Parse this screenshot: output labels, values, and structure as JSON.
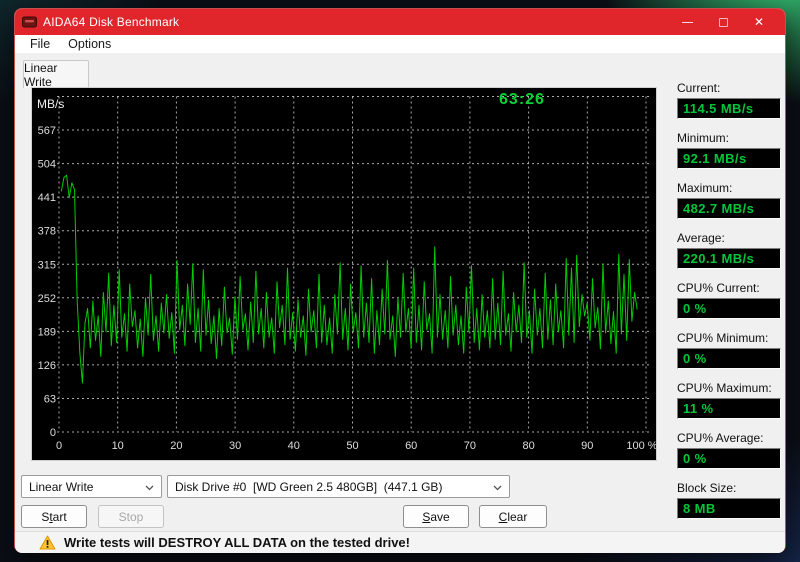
{
  "window": {
    "title": "AIDA64 Disk Benchmark"
  },
  "menu": {
    "items": [
      "File",
      "Options"
    ]
  },
  "tabs": [
    {
      "label": "Linear Write"
    }
  ],
  "icons": {
    "close": "✕",
    "minimize": "minimize-bar",
    "maximize": "maximize-box",
    "chevron": "chevron-down",
    "warning": "warning-triangle",
    "app": "aida64-logo"
  },
  "colors": {
    "titlebar_red": "#E0252B",
    "window_border": "#C7504E",
    "value_green": "#00C63A",
    "timer_green": "#00D435"
  },
  "chart_data": {
    "type": "line",
    "title": "Linear Write",
    "unit": "MB/s",
    "elapsed_time": "63:26",
    "ylabel": "MB/s",
    "y_ticks": [
      567,
      504,
      441,
      378,
      315,
      252,
      189,
      126,
      63,
      0
    ],
    "xlabel_ticks": [
      "0",
      "10",
      "20",
      "30",
      "40",
      "50",
      "60",
      "70",
      "80",
      "90",
      "100 %"
    ],
    "ylim": [
      0,
      630
    ],
    "xlim_pct": [
      0,
      100
    ],
    "x_start_pct": 0.4,
    "x_end_pct": 98.5,
    "grid": true,
    "line_color": "#00CC00",
    "grid_color": "#C8C8C8",
    "stats": {
      "current": 114.5,
      "minimum": 92.1,
      "maximum": 482.7,
      "average": 220.1
    },
    "values": [
      452,
      478,
      482,
      440,
      468,
      455,
      250,
      150,
      92,
      205,
      232,
      158,
      246,
      172,
      218,
      142,
      262,
      188,
      298,
      162,
      238,
      168,
      305,
      178,
      222,
      152,
      278,
      198,
      228,
      158,
      212,
      142,
      252,
      182,
      296,
      172,
      218,
      152,
      242,
      186,
      258,
      176,
      224,
      148,
      322,
      192,
      238,
      162,
      278,
      202,
      316,
      168,
      232,
      152,
      305,
      182,
      248,
      166,
      218,
      138,
      232,
      162,
      272,
      186,
      214,
      146,
      254,
      174,
      292,
      192,
      222,
      154,
      244,
      168,
      302,
      184,
      232,
      158,
      262,
      178,
      214,
      148,
      282,
      196,
      238,
      164,
      308,
      174,
      224,
      152,
      248,
      178,
      218,
      144,
      268,
      188,
      228,
      158,
      296,
      168,
      238,
      164,
      214,
      148,
      258,
      184,
      318,
      174,
      232,
      154,
      278,
      188,
      224,
      158,
      312,
      178,
      242,
      168,
      288,
      148,
      228,
      164,
      268,
      184,
      322,
      174,
      218,
      142,
      252,
      178,
      298,
      188,
      232,
      158,
      308,
      168,
      238,
      154,
      282,
      192,
      222,
      148,
      348,
      178,
      258,
      174,
      228,
      158,
      292,
      182,
      238,
      164,
      218,
      148,
      272,
      188,
      312,
      168,
      232,
      154,
      258,
      178,
      228,
      158,
      288,
      174,
      242,
      164,
      302,
      182,
      222,
      152,
      262,
      188,
      238,
      168,
      318,
      178,
      228,
      148,
      268,
      182,
      232,
      158,
      298,
      174,
      248,
      164,
      278,
      188,
      228,
      158,
      326,
      182,
      308,
      168,
      332,
      198,
      258,
      218,
      242,
      172,
      288,
      196,
      234,
      156,
      316,
      186,
      246,
      166,
      226,
      148,
      334,
      184,
      296,
      172,
      324,
      208,
      262,
      230
    ]
  },
  "stats": [
    {
      "label": "Current:",
      "value": "114.5 MB/s"
    },
    {
      "label": "Minimum:",
      "value": "92.1 MB/s"
    },
    {
      "label": "Maximum:",
      "value": "482.7 MB/s"
    },
    {
      "label": "Average:",
      "value": "220.1 MB/s"
    },
    {
      "label": "CPU% Current:",
      "value": "0 %"
    },
    {
      "label": "CPU% Minimum:",
      "value": "0 %"
    },
    {
      "label": "CPU% Maximum:",
      "value": "11 %"
    },
    {
      "label": "CPU% Average:",
      "value": "0 %"
    },
    {
      "label": "Block Size:",
      "value": "8 MB"
    }
  ],
  "controls": {
    "test_select": {
      "value": "Linear Write"
    },
    "drive_select": {
      "value": "Disk Drive #0  [WD Green 2.5 480GB]  (447.1 GB)"
    },
    "buttons": {
      "start": {
        "pre": "S",
        "accel": "t",
        "post": "art",
        "enabled": true
      },
      "stop": {
        "pre": "Stop",
        "accel": "",
        "post": "",
        "enabled": false
      },
      "save": {
        "pre": "",
        "accel": "S",
        "post": "ave",
        "enabled": true
      },
      "clear": {
        "pre": "",
        "accel": "C",
        "post": "lear",
        "enabled": true
      }
    }
  },
  "status_bar": {
    "warning": "Write tests will DESTROY ALL DATA on the tested drive!"
  }
}
